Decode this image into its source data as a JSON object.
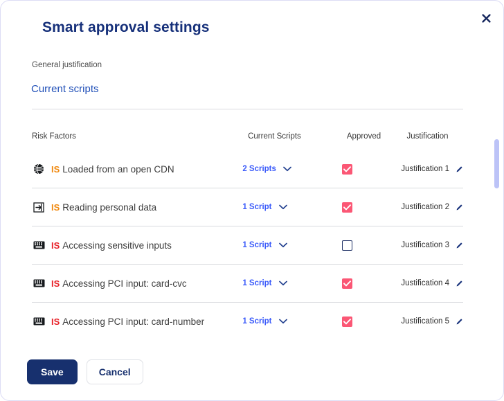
{
  "modal": {
    "title": "Smart approval settings",
    "close_icon": "close-icon"
  },
  "general": {
    "label": "General justification",
    "link": "Current scripts"
  },
  "table": {
    "headers": {
      "risk": "Risk Factors",
      "scripts": "Current Scripts",
      "approved": "Approved",
      "justification": "Justification"
    },
    "rows": [
      {
        "icon": "globe-icon",
        "badge": "IS",
        "badge_color": "#f08a12",
        "text": "Loaded from an open CDN",
        "scripts": "2 Scripts",
        "approved": true,
        "justification": "Justification 1"
      },
      {
        "icon": "arrow-into-box-icon",
        "badge": "IS",
        "badge_color": "#f08a12",
        "text": "Reading personal data",
        "scripts": "1 Script",
        "approved": true,
        "justification": "Justification 2"
      },
      {
        "icon": "keyboard-icon",
        "badge": "IS",
        "badge_color": "#e8232a",
        "text": "Accessing sensitive inputs",
        "scripts": "1 Script",
        "approved": false,
        "justification": "Justification 3"
      },
      {
        "icon": "keyboard-icon",
        "badge": "IS",
        "badge_color": "#e8232a",
        "text": "Accessing PCI input: card-cvc",
        "scripts": "1 Script",
        "approved": true,
        "justification": "Justification 4"
      },
      {
        "icon": "keyboard-icon",
        "badge": "IS",
        "badge_color": "#e8232a",
        "text": "Accessing PCI input: card-number",
        "scripts": "1 Script",
        "approved": true,
        "justification": "Justification 5"
      }
    ],
    "chevron_icon": "chevron-down-icon",
    "edit_icon": "pencil-icon"
  },
  "footer": {
    "save": "Save",
    "cancel": "Cancel"
  },
  "colors": {
    "title": "#16307a",
    "link": "#3b5bfa",
    "checkbox_on": "#fb5775",
    "primary_button": "#17306e",
    "scrollbar": "#bcc3f7"
  }
}
